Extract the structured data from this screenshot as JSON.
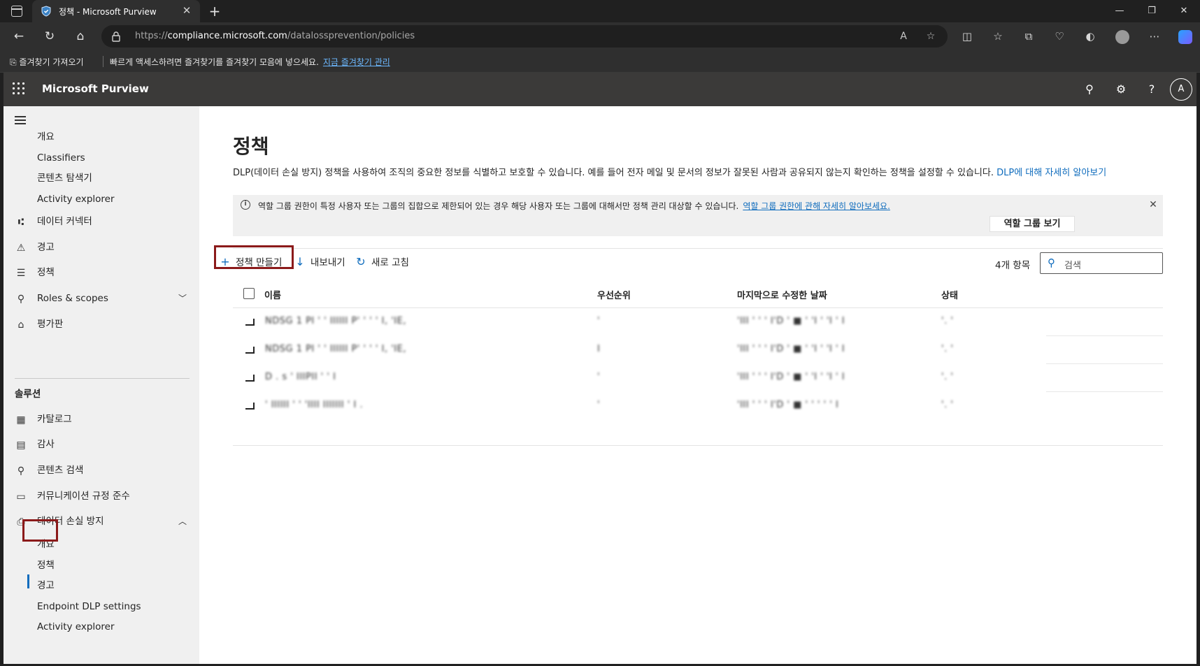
{
  "browser": {
    "tab_title": "정책 - Microsoft Purview",
    "tab_close": "✕",
    "new_tab": "+",
    "window_controls": [
      "—",
      "❐",
      "✕"
    ],
    "url_scheme": "https://",
    "url_host": "compliance.microsoft.com",
    "url_path": "/datalossprevention/policies",
    "favorites": {
      "import_label": "즐겨찾기 가져오기",
      "message": "빠르게 액세스하려면 즐겨찾기를 즐겨찾기 모음에 넣으세요.",
      "manage_link": "지금 즐겨찾기 관리"
    }
  },
  "app": {
    "name": "Microsoft Purview",
    "avatar_initial": "A"
  },
  "nav": {
    "items": [
      {
        "label": "개요"
      },
      {
        "label": "Classifiers"
      },
      {
        "label": "콘텐츠 탐색기"
      },
      {
        "label": "Activity explorer"
      },
      {
        "label": "데이터 커넥터",
        "icon": "data-connector-icon"
      },
      {
        "label": "경고",
        "icon": "alert-icon"
      },
      {
        "label": "정책",
        "icon": "policy-icon"
      },
      {
        "label": "Roles & scopes",
        "icon": "roles-icon"
      },
      {
        "label": "평가판",
        "icon": "trial-icon"
      }
    ],
    "section_title": "솔루션",
    "solutions": [
      {
        "label": "카탈로그",
        "icon": "catalog-icon"
      },
      {
        "label": "감사",
        "icon": "audit-icon"
      },
      {
        "label": "콘텐츠 검색",
        "icon": "content-search-icon"
      },
      {
        "label": "커뮤니케이션 규정 준수",
        "icon": "communication-icon"
      },
      {
        "label": "데이터 손실 방지",
        "icon": "dlp-icon"
      }
    ],
    "dlp_children": [
      {
        "label": "개요"
      },
      {
        "label": "정책"
      },
      {
        "label": "경고"
      },
      {
        "label": "Endpoint DLP settings"
      },
      {
        "label": "Activity explorer"
      }
    ]
  },
  "page": {
    "title": "정책",
    "description": "DLP(데이터 손실 방지) 정책을 사용하여 조직의 중요한 정보를 식별하고 보호할 수 있습니다. 예를 들어 전자 메일 및 문서의 정보가 잘못된 사람과 공유되지 않는지 확인하는 정책을 설정할 수 있습니다.",
    "description_link": "DLP에 대해 자세히 알아보기",
    "info_message": "역할 그룹 권한이 특정 사용자 또는 그룹의 집합으로 제한되어 있는 경우 해당 사용자 또는 그룹에 대해서만 정책 관리 대상할 수 있습니다.",
    "info_link": "역할 그룹 권한에 관해 자세히 알아보세요.",
    "role_button": "역할 그룹 보기",
    "commands": {
      "create": "정책 만들기",
      "export": "내보내기",
      "refresh": "새로 고침"
    },
    "item_count": "4개 항목",
    "search_placeholder": "검색",
    "columns": [
      "이름",
      "우선순위",
      "마지막으로 수정한 날짜",
      "상태"
    ],
    "rows": [
      {
        "name": "NDSG 1 PI ' ' IIIIII P' ' ' ' I, 'IE, ",
        "priority": "' ",
        "modified": "'III ' ' ' I'D ' ■ ' 'I ' 'I ' I",
        "status": "'. '"
      },
      {
        "name": "NDSG 1 PI ' ' IIIIII P' ' ' ' I, 'IE, ",
        "priority": "I",
        "modified": "'III ' ' ' I'D ' ■ ' 'I ' 'I ' I",
        "status": "'. '"
      },
      {
        "name": "D . s ' IIIPII ' ' I ",
        "priority": "' ",
        "modified": "'III ' ' ' I'D ' ■ ' 'I ' 'I ' I",
        "status": "'. '"
      },
      {
        "name": "' IIIIII ' ' 'IIII IIIIIII ' I . ",
        "priority": "' ",
        "modified": "'III ' ' ' I'D ' ■ ' ' ' ' ' I",
        "status": "'. '"
      }
    ]
  }
}
